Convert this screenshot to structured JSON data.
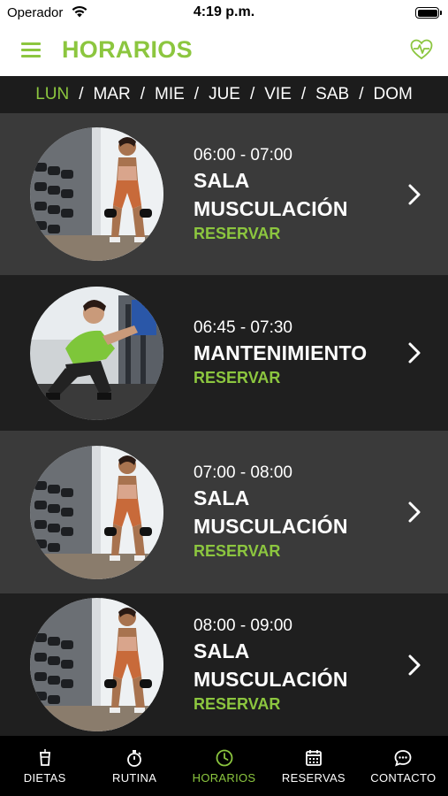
{
  "status": {
    "carrier": "Operador",
    "time": "4:19 p.m.",
    "battery_level": 1.0
  },
  "header": {
    "title": "HORARIOS",
    "menu_icon": "hamburger-menu-icon",
    "action_icon": "heart-pulse-icon"
  },
  "days": [
    {
      "label": "LUN",
      "active": true
    },
    {
      "label": "MAR",
      "active": false
    },
    {
      "label": "MIE",
      "active": false
    },
    {
      "label": "JUE",
      "active": false
    },
    {
      "label": "VIE",
      "active": false
    },
    {
      "label": "SAB",
      "active": false
    },
    {
      "label": "DOM",
      "active": false
    }
  ],
  "day_separator": "/",
  "classes": [
    {
      "time": "06:00 - 07:00",
      "name_line1": "SALA",
      "name_line2": "MUSCULACIÓN",
      "action": "RESERVAR",
      "image": "woman-lunge-dumbbell-rack"
    },
    {
      "time": "06:45 - 07:30",
      "name_line1": "MANTENIMIENTO",
      "name_line2": "",
      "action": "RESERVAR",
      "image": "woman-squat-green-top"
    },
    {
      "time": "07:00 - 08:00",
      "name_line1": "SALA",
      "name_line2": "MUSCULACIÓN",
      "action": "RESERVAR",
      "image": "woman-lunge-dumbbell-rack"
    },
    {
      "time": "08:00 - 09:00",
      "name_line1": "SALA",
      "name_line2": "MUSCULACIÓN",
      "action": "RESERVAR",
      "image": "woman-lunge-dumbbell-rack"
    }
  ],
  "tabs": [
    {
      "label": "DIETAS",
      "icon": "cup-icon",
      "active": false
    },
    {
      "label": "RUTINA",
      "icon": "stopwatch-icon",
      "active": false
    },
    {
      "label": "HORARIOS",
      "icon": "clock-icon",
      "active": true
    },
    {
      "label": "RESERVAS",
      "icon": "calendar-icon",
      "active": false
    },
    {
      "label": "CONTACTO",
      "icon": "chat-bubble-icon",
      "active": false
    }
  ],
  "colors": {
    "accent": "#8cc63f",
    "row_light": "#3a3a3a",
    "row_dark": "#1f1f1f",
    "tab_bg": "#000000"
  }
}
